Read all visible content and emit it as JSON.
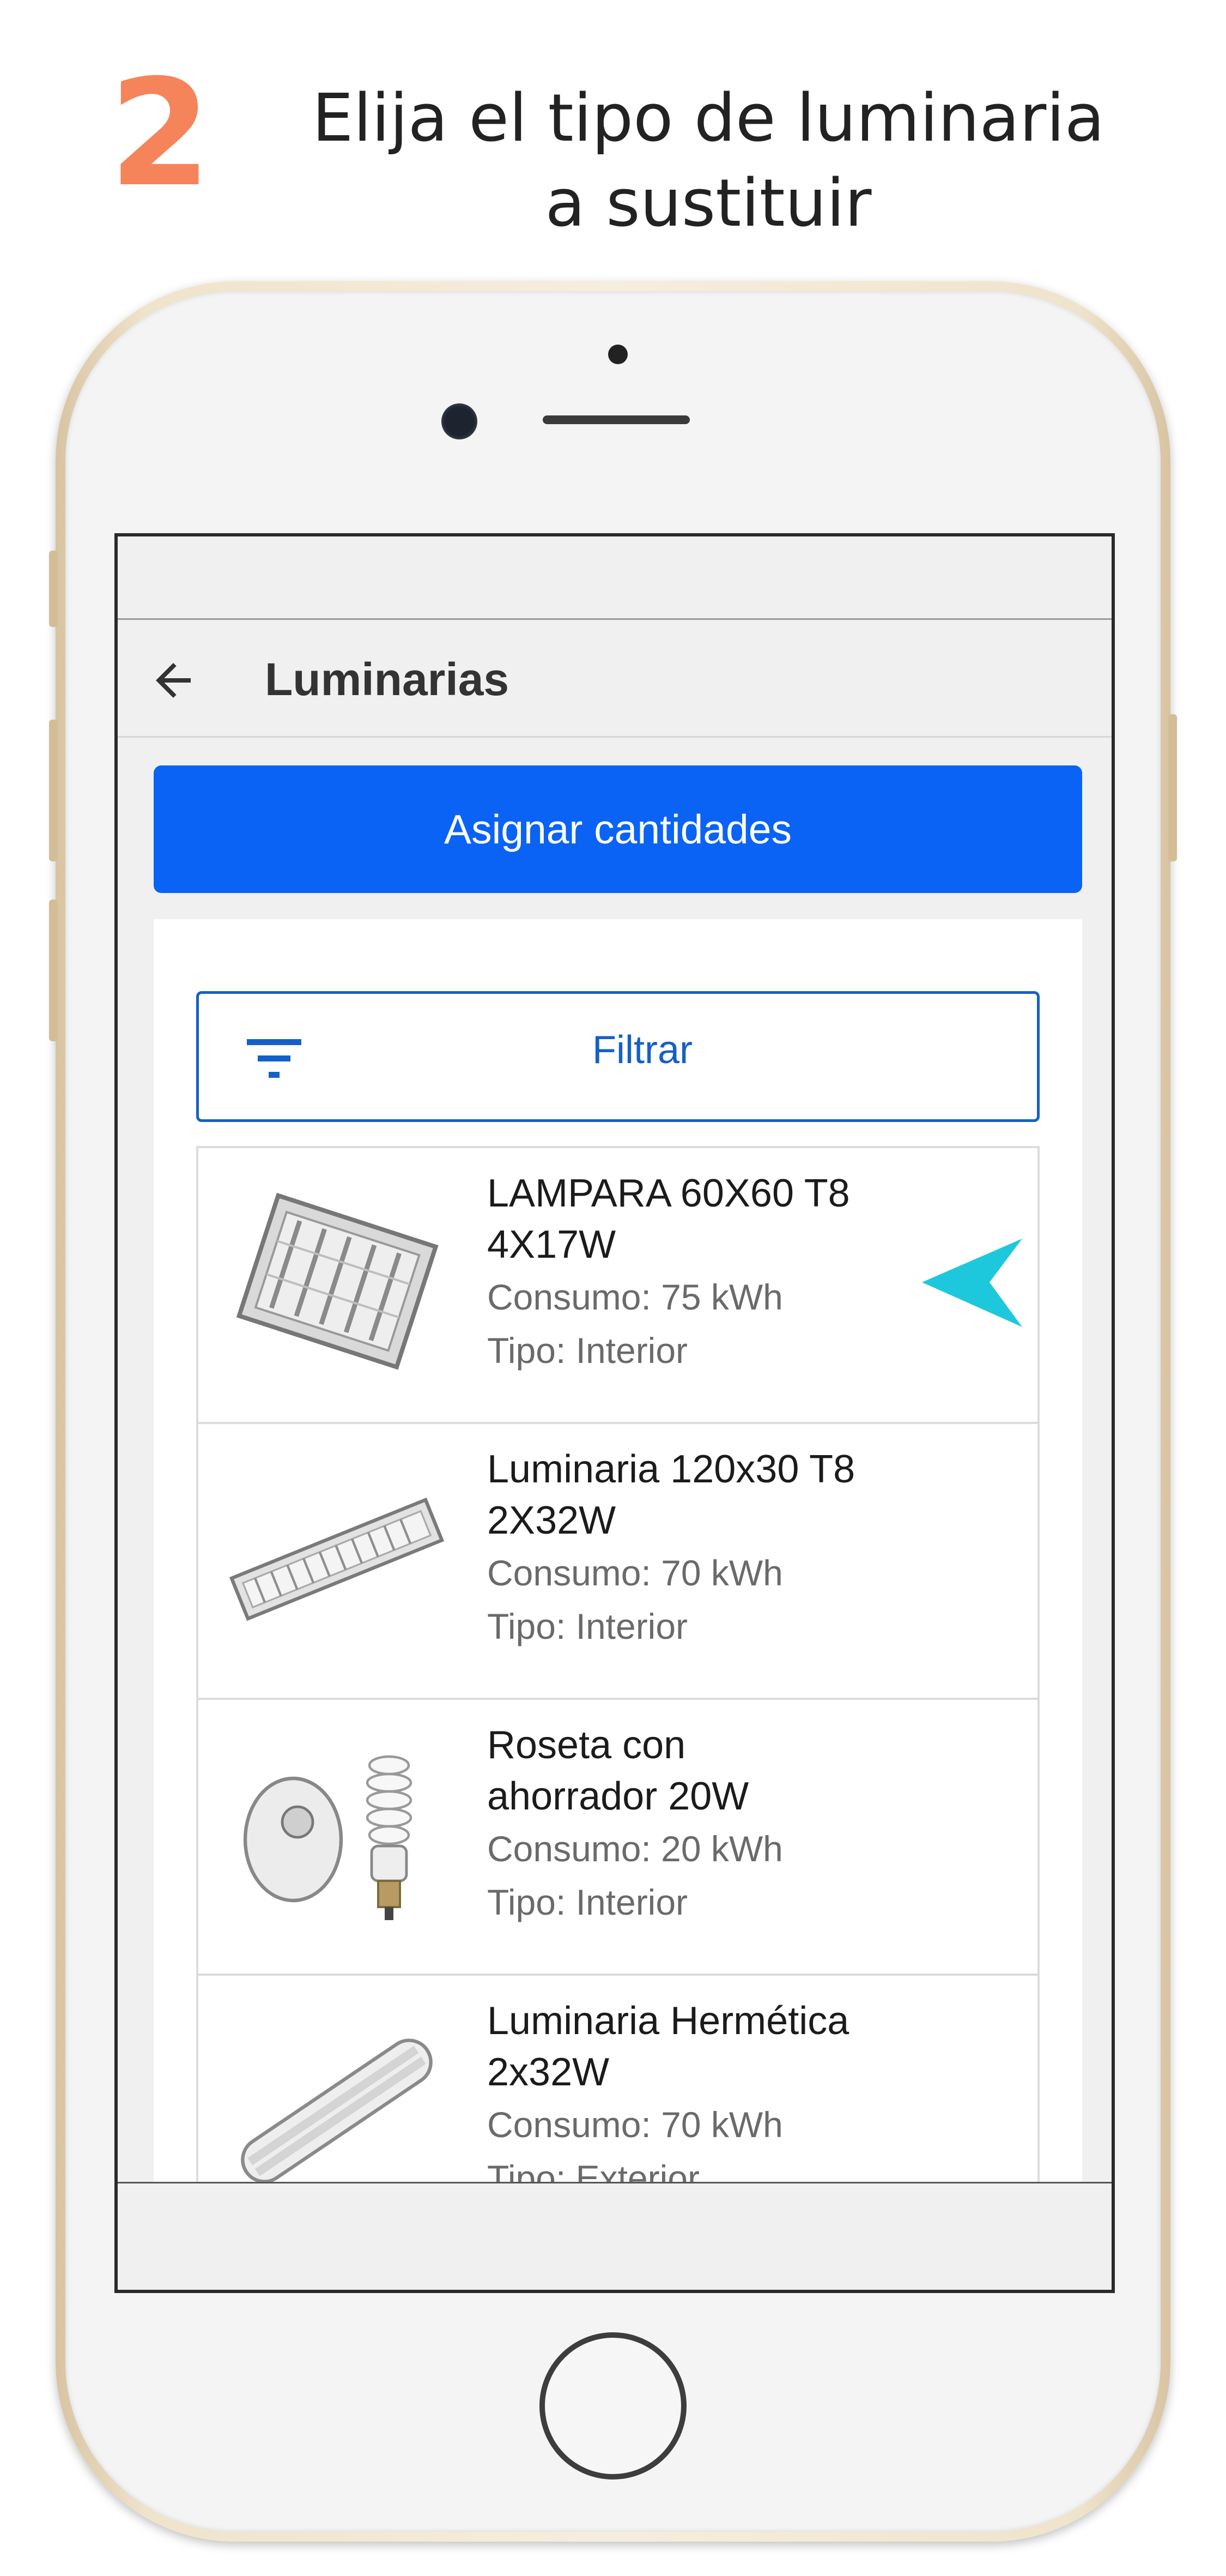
{
  "header": {
    "step_number": "2",
    "title_line1": "Elija el tipo de luminaria",
    "title_line2": "a sustituir"
  },
  "app": {
    "title": "Luminarias",
    "back_icon": "arrow-back-icon",
    "assign_button": "Asignar cantidades",
    "filter_button": "Filtrar",
    "filter_icon": "filter-icon"
  },
  "items": [
    {
      "name_line1": "LAMPARA 60X60 T8",
      "name_line2": "4X17W",
      "consumo": "Consumo: 75 kWh",
      "tipo": "Tipo: Interior",
      "image": "square-recessed-fluorescent-fixture"
    },
    {
      "name_line1": "Luminaria 120x30 T8",
      "name_line2": "2X32W",
      "consumo": "Consumo: 70 kWh",
      "tipo": "Tipo: Interior",
      "image": "linear-fluorescent-fixture"
    },
    {
      "name_line1": "Roseta con",
      "name_line2": "ahorrador 20W",
      "consumo": "Consumo: 20 kWh",
      "tipo": "Tipo: Interior",
      "image": "socket-and-cfl-bulb"
    },
    {
      "name_line1": "Luminaria Hermética",
      "name_line2": "2x32W",
      "consumo": "Consumo: 70 kWh",
      "tipo": "Tipo: Exterior",
      "image": "hermetic-tube-fixture"
    }
  ],
  "colors": {
    "step_accent": "#f5845a",
    "primary_button": "#0a63f5",
    "filter_accent": "#1560c8",
    "pointer_arrow": "#1ec8dc"
  }
}
